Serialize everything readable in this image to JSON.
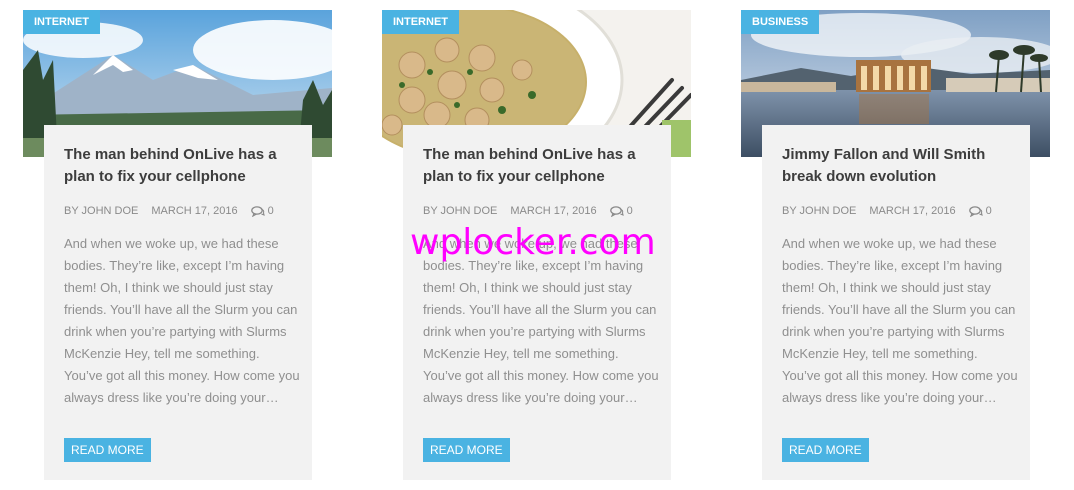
{
  "posts": [
    {
      "category": "Internet",
      "title": "The man behind OnLive has a plan to fix your cellphone",
      "author": "By John Doe",
      "date": "March 17, 2016",
      "comments": "0",
      "excerpt": "And when we woke up, we had these bodies. They’re like, except I’m having them! Oh, I think we should just stay friends. You’ll have all the Slurm you can drink when you’re partying with Slurms McKenzie Hey, tell me something. You’ve got all this money. How come you always dress like you’re doing your…",
      "read_more": "Read More"
    },
    {
      "category": "Internet",
      "title": "The man behind OnLive has a plan to fix your cellphone",
      "author": "By John Doe",
      "date": "March 17, 2016",
      "comments": "0",
      "excerpt": "And when we woke up, we had these bodies. They’re like, except I’m having them! Oh, I think we should just stay friends. You’ll have all the Slurm you can drink when you’re partying with Slurms McKenzie Hey, tell me something. You’ve got all this money. How come you always dress like you’re doing your…",
      "read_more": "Read More"
    },
    {
      "category": "Business",
      "title": "Jimmy Fallon and Will Smith break down evolution",
      "author": "By John Doe",
      "date": "March 17, 2016",
      "comments": "0",
      "excerpt": "And when we woke up, we had these bodies. They’re like, except I’m having them! Oh, I think we should just stay friends. You’ll have all the Slurm you can drink when you’re partying with Slurms McKenzie Hey, tell me something. You’ve got all this money. How come you always dress like you’re doing your…",
      "read_more": "Read More"
    }
  ],
  "watermark": "wplocker.com",
  "colors": {
    "accent": "#4ab3e2",
    "card_bg": "#f2f2f2",
    "watermark": "#ff00ff"
  }
}
